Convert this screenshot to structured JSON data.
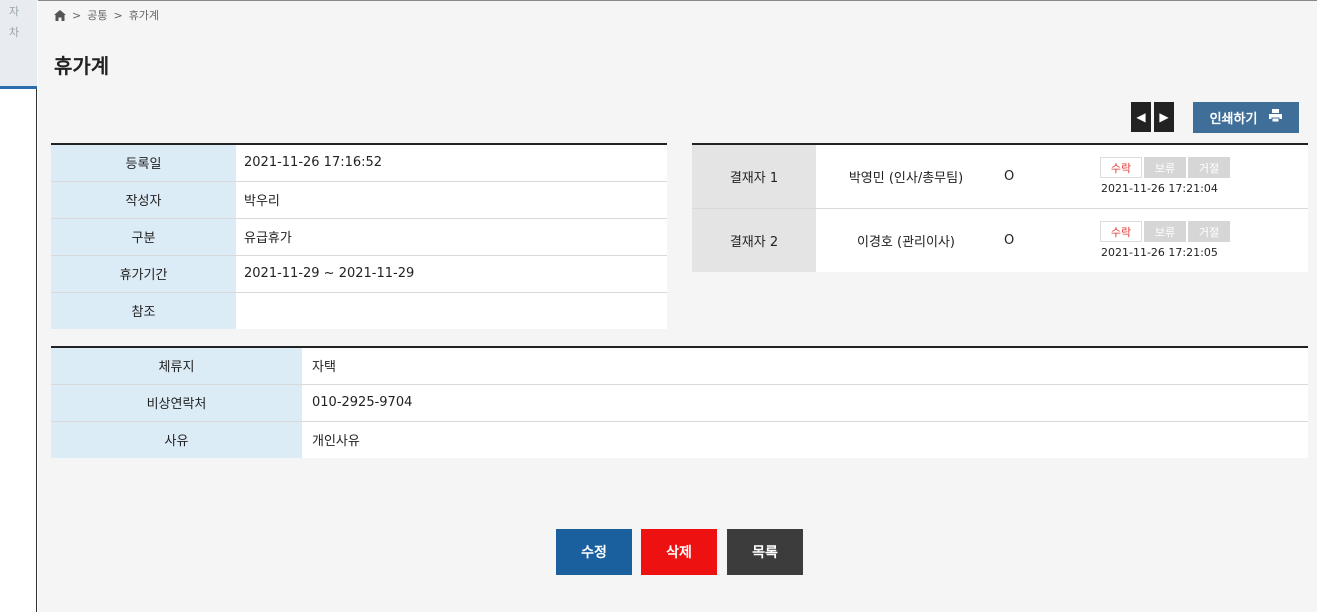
{
  "background_window": {
    "line1": "자",
    "line2": "차"
  },
  "breadcrumb": {
    "sep1": ">",
    "item1": "공통",
    "sep2": ">",
    "item2": "휴가계"
  },
  "page_title": "휴가계",
  "toolbar": {
    "prev_glyph": "◀",
    "next_glyph": "▶",
    "print_label": "인쇄하기",
    "print_icon": "printer-icon"
  },
  "info": [
    {
      "label": "등록일",
      "value": "2021-11-26 17:16:52"
    },
    {
      "label": "작성자",
      "value": "박우리"
    },
    {
      "label": "구분",
      "value": "유급휴가"
    },
    {
      "label": "휴가기간",
      "value": "2021-11-29 ~ 2021-11-29"
    },
    {
      "label": "참조",
      "value": ""
    }
  ],
  "approvers": [
    {
      "label": "결재자 1",
      "name": "박영민 (인사/총무팀)",
      "mark": "O",
      "accept": "수락",
      "hold": "보류",
      "reject": "거절",
      "timestamp": "2021-11-26 17:21:04"
    },
    {
      "label": "결재자 2",
      "name": "이경호 (관리이사)",
      "mark": "O",
      "accept": "수락",
      "hold": "보류",
      "reject": "거절",
      "timestamp": "2021-11-26 17:21:05"
    }
  ],
  "details": [
    {
      "label": "체류지",
      "value": "자택"
    },
    {
      "label": "비상연락처",
      "value": "010-2925-9704"
    },
    {
      "label": "사유",
      "value": "개인사유"
    }
  ],
  "actions": {
    "edit": "수정",
    "delete": "삭제",
    "list": "목록"
  },
  "colors": {
    "label_bg": "#dcecf7",
    "print_btn": "#3f6e99",
    "edit_btn": "#1a5f9e",
    "delete_btn": "#ee1111",
    "list_btn": "#3c3c3c",
    "accept_text": "#e53935"
  }
}
